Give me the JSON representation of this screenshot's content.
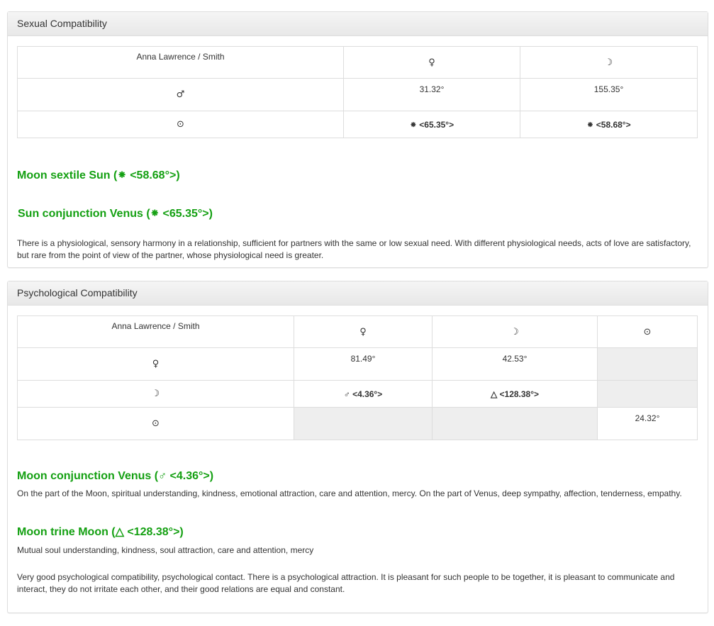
{
  "sexual": {
    "title": "Sexual Compatibility",
    "table": {
      "corner": "Anna Lawrence / Smith",
      "col1": "♀",
      "col2": "☽",
      "row1": {
        "symbol": "♂",
        "c1": "31.32°",
        "c2": "155.35°"
      },
      "row2": {
        "symbol": "⊙",
        "c1": "⁕ <65.35°>",
        "c2": "⁕ <58.68°>"
      }
    },
    "aspect1": "Moon sextile Sun (⁕ <58.68°>)",
    "aspect2": "Sun conjunction Venus (⁕ <65.35°>)",
    "summary": "There is a physiological, sensory harmony in a relationship, sufficient for partners with the same or low sexual need. With different physiological needs, acts of love are satisfactory, but rare from the point of view of the partner, whose physiological need is greater."
  },
  "psych": {
    "title": "Psychological Compatibility",
    "table": {
      "corner": "Anna Lawrence / Smith",
      "col1": "♀",
      "col2": "☽",
      "col3": "⊙",
      "row1": {
        "symbol": "♀",
        "c1": "81.49°",
        "c2": "42.53°"
      },
      "row2": {
        "symbol": "☽",
        "c1": "♂ <4.36°>",
        "c2": "△ <128.38°>"
      },
      "row3": {
        "symbol": "⊙",
        "c3": "24.32°"
      }
    },
    "aspect1": "Moon conjunction Venus (♂ <4.36°>)",
    "aspect1_desc": "On the part of the Moon, spiritual understanding, kindness, emotional attraction, care and attention, mercy. On the part of Venus, deep sympathy, affection, tenderness, empathy.",
    "aspect2": "Moon trine Moon (△ <128.38°>)",
    "aspect2_desc": "Mutual soul understanding, kindness, soul attraction, care and attention, mercy",
    "summary": "Very good psychological compatibility, psychological contact. There is a psychological attraction. It is pleasant for such people to be together, it is pleasant to communicate and interact, they do not irritate each other, and their good relations are equal and constant."
  },
  "colors": {
    "accent_green": "#14a012",
    "border": "#dddddd",
    "empty_cell": "#eeeeee"
  }
}
